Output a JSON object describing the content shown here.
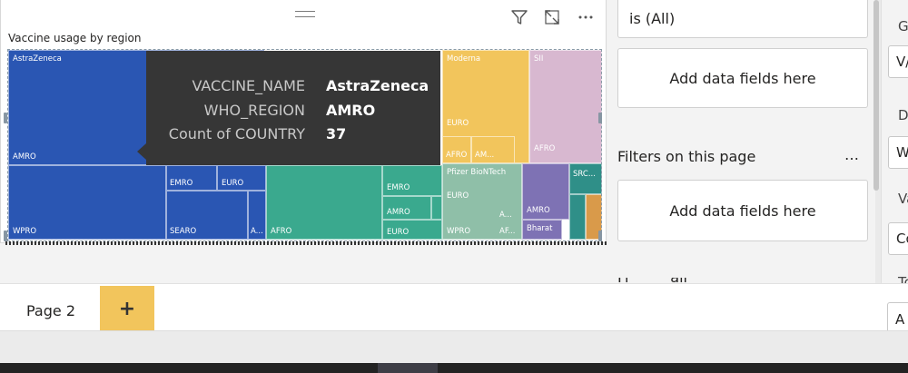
{
  "visual": {
    "title": "Vaccine usage by region"
  },
  "treemap": {
    "astrazeneca": {
      "name": "AstraZeneca",
      "regions": [
        "AMRO",
        "WPRO",
        "EMRO",
        "EURO",
        "SEARO",
        "A..."
      ]
    },
    "teal": {
      "regions": [
        "AFRO",
        "EMRO",
        "AMRO",
        "EURO"
      ]
    },
    "moderna": {
      "name": "Moderna",
      "regions": [
        "EURO",
        "AFRO",
        "AM..."
      ]
    },
    "sii": {
      "name": "SII",
      "regions": [
        "AFRO"
      ]
    },
    "pfizer": {
      "name": "Pfizer BioNTech",
      "regions": [
        "EURO",
        "A...",
        "WPRO",
        "AF..."
      ]
    },
    "purple": {
      "regions": [
        "AMRO"
      ]
    },
    "bharat": {
      "name": "Bharat"
    },
    "src": {
      "name": "SRC..."
    }
  },
  "tooltip": {
    "rows": [
      {
        "key": "VACCINE_NAME",
        "value": "AstraZeneca"
      },
      {
        "key": "WHO_REGION",
        "value": "AMRO"
      },
      {
        "key": "Count of COUNTRY",
        "value": "37"
      }
    ]
  },
  "filters": {
    "top_value": "is (All)",
    "add_fields_1": "Add data fields here",
    "page_heading": "Filters on this page",
    "more": "…",
    "add_fields_2": "Add data fields here"
  },
  "viz_pane": {
    "label_g": "G",
    "box_va": "V/",
    "label_d": "De",
    "box_w": "W",
    "label_va": "Va",
    "box_co": "Co",
    "label_to": "To",
    "box_a": "A"
  },
  "pages": {
    "tab1": "Page 2",
    "add": "+"
  },
  "colors": {
    "astrazeneca": "#2a56b3",
    "teal": "#3aa98e",
    "moderna": "#f2c55c",
    "sii": "#d8b8d0",
    "pfizer": "#8fbfa8",
    "tooltip_bg": "#363636"
  }
}
